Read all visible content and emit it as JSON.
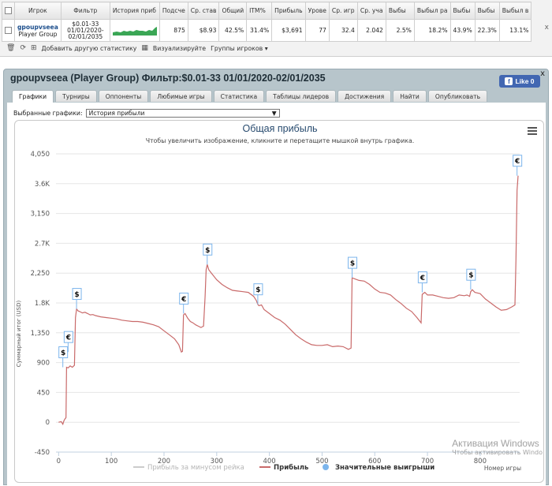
{
  "stats_table": {
    "headers": [
      "Игрок",
      "Фильтр",
      "История приб",
      "Подсче",
      "Ср. став",
      "Общий",
      "ITM%",
      "Прибыль",
      "Урове",
      "Ср. игр",
      "Ср. уча",
      "Выбы",
      "Выбыл ра",
      "Выбы",
      "Выбы",
      "Выбыл в"
    ],
    "row": {
      "player_name": "gpoupvseea",
      "player_group": "Player Group",
      "filter_line1": "$0.01-33",
      "filter_line2": "01/01/2020-",
      "filter_line3": "02/01/2035",
      "count": "875",
      "avg_stake": "$8.93",
      "total": "42.5%",
      "itm": "31.4%",
      "profit": "$3,691",
      "level": "77",
      "avg_game": "32.4",
      "avg_part": "2.042",
      "out1": "2.5%",
      "out2": "18.2%",
      "out3": "43.9%",
      "out4": "22.3%",
      "out5": "13.1%"
    },
    "spark_color": "#3aa655",
    "close_label": "x"
  },
  "toolbar": {
    "add_stats": "Добавить другую статистику",
    "visualize": "Визуализируйте",
    "groups": "Группы игроков"
  },
  "panel": {
    "title": "gpoupvseea (Player Group) Фильтр:$0.01-33 01/01/2020-02/01/2035",
    "close": "x",
    "like": "Like 0",
    "tabs": [
      "Графики",
      "Турниры",
      "Оппоненты",
      "Любимые игры",
      "Статистика",
      "Таблицы лидеров",
      "Достижения",
      "Найти",
      "Опубликовать"
    ],
    "active_tab": 0,
    "select_label": "Выбранные графики:",
    "select_value": "История прибыли"
  },
  "chart_data": {
    "type": "line",
    "title": "Общая прибыль",
    "subtitle": "Чтобы увеличить изображение, кликните и перетащите мышкой внутрь графика.",
    "ylabel": "Суммарный итог (USD)",
    "xlabel": "Номер игры",
    "ylim": [
      -450,
      4050
    ],
    "xlim": [
      -5,
      875
    ],
    "y_ticks": [
      "4,050",
      "3.6K",
      "3,150",
      "2.7K",
      "2,250",
      "1.8K",
      "1,350",
      "900",
      "450",
      "0",
      "-450"
    ],
    "y_tick_values": [
      4050,
      3600,
      3150,
      2700,
      2250,
      1800,
      1350,
      900,
      450,
      0,
      -450
    ],
    "x_ticks": [
      "0",
      "100",
      "200",
      "300",
      "400",
      "500",
      "600",
      "700",
      "800"
    ],
    "x_tick_values": [
      0,
      100,
      200,
      300,
      400,
      500,
      600,
      700,
      800
    ],
    "grid": "horizontal",
    "legend_position": "bottom",
    "series": [
      {
        "name": "Прибыль за минусом рейка",
        "color": "#cccccc",
        "visible": false
      },
      {
        "name": "Прибыль",
        "color": "#c96a6a",
        "visible": true,
        "points": [
          [
            0,
            0
          ],
          [
            5,
            10
          ],
          [
            8,
            -30
          ],
          [
            10,
            20
          ],
          [
            12,
            50
          ],
          [
            14,
            70
          ],
          [
            15,
            830
          ],
          [
            18,
            820
          ],
          [
            22,
            850
          ],
          [
            26,
            830
          ],
          [
            30,
            860
          ],
          [
            32,
            1580
          ],
          [
            34,
            1710
          ],
          [
            37,
            1680
          ],
          [
            40,
            1670
          ],
          [
            45,
            1650
          ],
          [
            50,
            1660
          ],
          [
            55,
            1640
          ],
          [
            60,
            1620
          ],
          [
            65,
            1625
          ],
          [
            70,
            1610
          ],
          [
            80,
            1590
          ],
          [
            90,
            1580
          ],
          [
            100,
            1570
          ],
          [
            110,
            1560
          ],
          [
            120,
            1540
          ],
          [
            130,
            1530
          ],
          [
            140,
            1520
          ],
          [
            150,
            1520
          ],
          [
            160,
            1510
          ],
          [
            170,
            1490
          ],
          [
            180,
            1470
          ],
          [
            190,
            1440
          ],
          [
            200,
            1380
          ],
          [
            210,
            1320
          ],
          [
            220,
            1260
          ],
          [
            228,
            1170
          ],
          [
            233,
            1060
          ],
          [
            235,
            1070
          ],
          [
            237,
            1620
          ],
          [
            240,
            1640
          ],
          [
            245,
            1570
          ],
          [
            250,
            1520
          ],
          [
            255,
            1500
          ],
          [
            260,
            1470
          ],
          [
            265,
            1450
          ],
          [
            270,
            1430
          ],
          [
            275,
            1450
          ],
          [
            278,
            1900
          ],
          [
            280,
            2300
          ],
          [
            282,
            2380
          ],
          [
            285,
            2300
          ],
          [
            290,
            2250
          ],
          [
            300,
            2150
          ],
          [
            310,
            2080
          ],
          [
            320,
            2030
          ],
          [
            330,
            1990
          ],
          [
            340,
            1980
          ],
          [
            350,
            1970
          ],
          [
            360,
            1960
          ],
          [
            370,
            1900
          ],
          [
            375,
            1840
          ],
          [
            378,
            1780
          ],
          [
            380,
            1760
          ],
          [
            385,
            1770
          ],
          [
            390,
            1700
          ],
          [
            400,
            1640
          ],
          [
            410,
            1580
          ],
          [
            420,
            1540
          ],
          [
            430,
            1480
          ],
          [
            440,
            1400
          ],
          [
            450,
            1320
          ],
          [
            460,
            1260
          ],
          [
            470,
            1210
          ],
          [
            480,
            1170
          ],
          [
            490,
            1160
          ],
          [
            500,
            1160
          ],
          [
            510,
            1170
          ],
          [
            520,
            1140
          ],
          [
            530,
            1150
          ],
          [
            540,
            1140
          ],
          [
            550,
            1100
          ],
          [
            555,
            1120
          ],
          [
            557,
            2180
          ],
          [
            560,
            2170
          ],
          [
            570,
            2140
          ],
          [
            580,
            2130
          ],
          [
            590,
            2080
          ],
          [
            600,
            2010
          ],
          [
            610,
            1960
          ],
          [
            620,
            1950
          ],
          [
            630,
            1920
          ],
          [
            640,
            1850
          ],
          [
            650,
            1790
          ],
          [
            660,
            1720
          ],
          [
            670,
            1670
          ],
          [
            680,
            1580
          ],
          [
            688,
            1500
          ],
          [
            690,
            1930
          ],
          [
            695,
            1960
          ],
          [
            700,
            1920
          ],
          [
            710,
            1920
          ],
          [
            720,
            1900
          ],
          [
            730,
            1880
          ],
          [
            740,
            1870
          ],
          [
            750,
            1880
          ],
          [
            760,
            1920
          ],
          [
            770,
            1910
          ],
          [
            775,
            1920
          ],
          [
            780,
            1900
          ],
          [
            782,
            1970
          ],
          [
            785,
            2000
          ],
          [
            790,
            1960
          ],
          [
            800,
            1940
          ],
          [
            810,
            1860
          ],
          [
            820,
            1800
          ],
          [
            830,
            1740
          ],
          [
            840,
            1690
          ],
          [
            850,
            1700
          ],
          [
            860,
            1740
          ],
          [
            866,
            1770
          ],
          [
            868,
            2450
          ],
          [
            870,
            3500
          ],
          [
            872,
            3720
          ]
        ]
      },
      {
        "name": "Значительные выигрыши",
        "color": "#7cb5ec",
        "visible": true
      }
    ],
    "markers": [
      {
        "x": 8,
        "y": 830,
        "label": "$"
      },
      {
        "x": 18,
        "y": 1060,
        "label": "€"
      },
      {
        "x": 34,
        "y": 1710,
        "label": "$"
      },
      {
        "x": 237,
        "y": 1640,
        "label": "€"
      },
      {
        "x": 282,
        "y": 2380,
        "label": "$"
      },
      {
        "x": 378,
        "y": 1780,
        "label": "$"
      },
      {
        "x": 557,
        "y": 2180,
        "label": "$"
      },
      {
        "x": 690,
        "y": 1960,
        "label": "€"
      },
      {
        "x": 782,
        "y": 2000,
        "label": "$"
      },
      {
        "x": 870,
        "y": 3720,
        "label": "€"
      }
    ]
  },
  "watermark": {
    "line1": "Активация Windows",
    "line2": "Чтобы активировать Windo"
  }
}
